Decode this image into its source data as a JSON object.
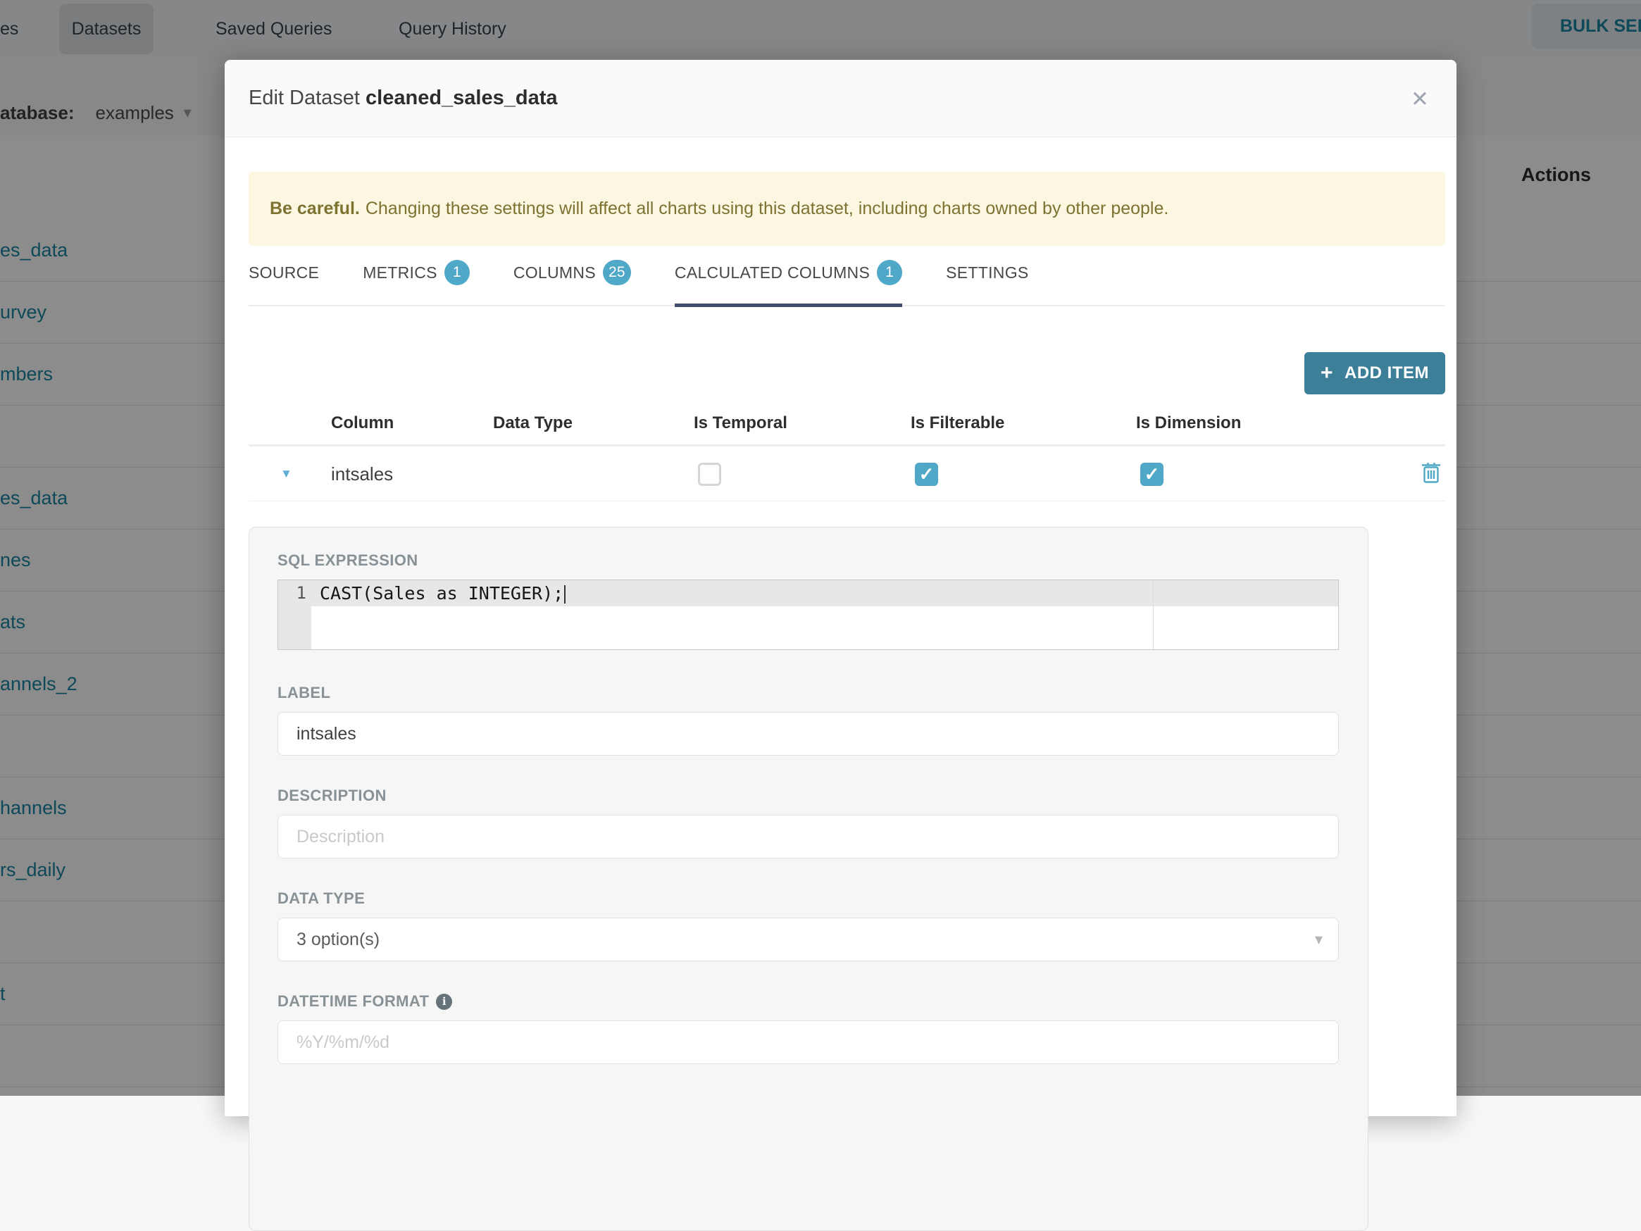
{
  "background": {
    "topnav": {
      "partial_left_item": "es",
      "items": [
        {
          "label": "Datasets",
          "active": true
        },
        {
          "label": "Saved Queries"
        },
        {
          "label": "Query History"
        }
      ],
      "bulk_select_label": "BULK SELECT"
    },
    "filter_bar": {
      "database_label": "atabase:",
      "database_value": "examples"
    },
    "table": {
      "actions_header": "Actions",
      "rows": [
        {
          "label": "es_data"
        },
        {
          "label": "urvey"
        },
        {
          "label": "mbers"
        },
        {
          "label": ""
        },
        {
          "label": "es_data"
        },
        {
          "label": "nes"
        },
        {
          "label": "ats"
        },
        {
          "label": "annels_2"
        },
        {
          "label": ""
        },
        {
          "label": "hannels"
        },
        {
          "label": "rs_daily"
        },
        {
          "label": ""
        },
        {
          "label": "t"
        },
        {
          "label": ""
        }
      ]
    }
  },
  "modal": {
    "title_prefix": "Edit Dataset",
    "dataset_name": "cleaned_sales_data",
    "warning": {
      "bold": "Be careful.",
      "text": "Changing these settings will affect all charts using this dataset, including charts owned by other people."
    },
    "tabs": [
      {
        "label": "SOURCE"
      },
      {
        "label": "METRICS",
        "badge": "1"
      },
      {
        "label": "COLUMNS",
        "badge": "25"
      },
      {
        "label": "CALCULATED COLUMNS",
        "badge": "1",
        "active": true
      },
      {
        "label": "SETTINGS"
      }
    ],
    "add_item_label": "ADD ITEM",
    "columns_table": {
      "headers": [
        "Column",
        "Data Type",
        "Is Temporal",
        "Is Filterable",
        "Is Dimension"
      ],
      "row": {
        "name": "intsales",
        "is_temporal": false,
        "is_filterable": true,
        "is_dimension": true
      }
    },
    "editor": {
      "section_label": "SQL EXPRESSION",
      "line_number": "1",
      "code": "CAST(Sales as INTEGER);"
    },
    "fields": {
      "label": {
        "label": "LABEL",
        "value": "intsales"
      },
      "description": {
        "label": "DESCRIPTION",
        "placeholder": "Description"
      },
      "data_type": {
        "label": "DATA TYPE",
        "value": "3 option(s)"
      },
      "datetime_format": {
        "label": "DATETIME FORMAT",
        "placeholder": "%Y/%m/%d"
      }
    }
  },
  "icons": {
    "close": "✕",
    "caret_down": "▾",
    "expand_caret": "▼",
    "plus": "+",
    "check": "✓",
    "info": "i"
  },
  "colors": {
    "accent_teal": "#4FA8C7",
    "button_teal": "#3D7E99",
    "tab_underline": "#414B6E",
    "warning_bg": "#FBF7E0",
    "warning_text": "#7E7233",
    "link": "#1985A0"
  }
}
